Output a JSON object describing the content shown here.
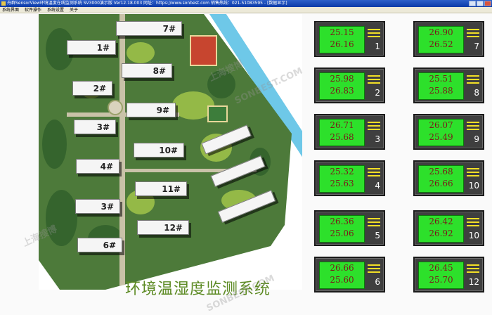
{
  "window": {
    "title": "舟群SensorView环境温度在线监测系统 SV3000演示版 Ver12.18.003  网址：https://www.sonbest.com  销售热线：021-51083595 - [数据显示]"
  },
  "menu": [
    "系统界面",
    "软件操作",
    "系统设置",
    "关于"
  ],
  "site_title": "环境温湿度监测系统",
  "buildings": [
    "1#",
    "2#",
    "3#",
    "4#",
    "3#",
    "6#",
    "7#",
    "8#",
    "9#",
    "10#",
    "11#",
    "12#"
  ],
  "panels": [
    {
      "temp": "25.15",
      "humid": "26.16",
      "id": "1"
    },
    {
      "temp": "26.90",
      "humid": "26.52",
      "id": "7"
    },
    {
      "temp": "25.98",
      "humid": "26.83",
      "id": "2"
    },
    {
      "temp": "25.51",
      "humid": "25.88",
      "id": "8"
    },
    {
      "temp": "26.71",
      "humid": "25.68",
      "id": "3"
    },
    {
      "temp": "26.07",
      "humid": "25.49",
      "id": "9"
    },
    {
      "temp": "25.32",
      "humid": "25.63",
      "id": "4"
    },
    {
      "temp": "25.68",
      "humid": "26.66",
      "id": "10"
    },
    {
      "temp": "26.36",
      "humid": "25.06",
      "id": "5"
    },
    {
      "temp": "26.42",
      "humid": "26.92",
      "id": "10"
    },
    {
      "temp": "26.66",
      "humid": "25.60",
      "id": "6"
    },
    {
      "temp": "26.45",
      "humid": "25.70",
      "id": "12"
    }
  ],
  "watermarks": [
    "上海搜博",
    "SONBEST.COM"
  ],
  "colors": {
    "screen": "#2de02b",
    "reading": "#7a1a1a",
    "bars": "#f2df26",
    "title": "#5c8a23"
  }
}
